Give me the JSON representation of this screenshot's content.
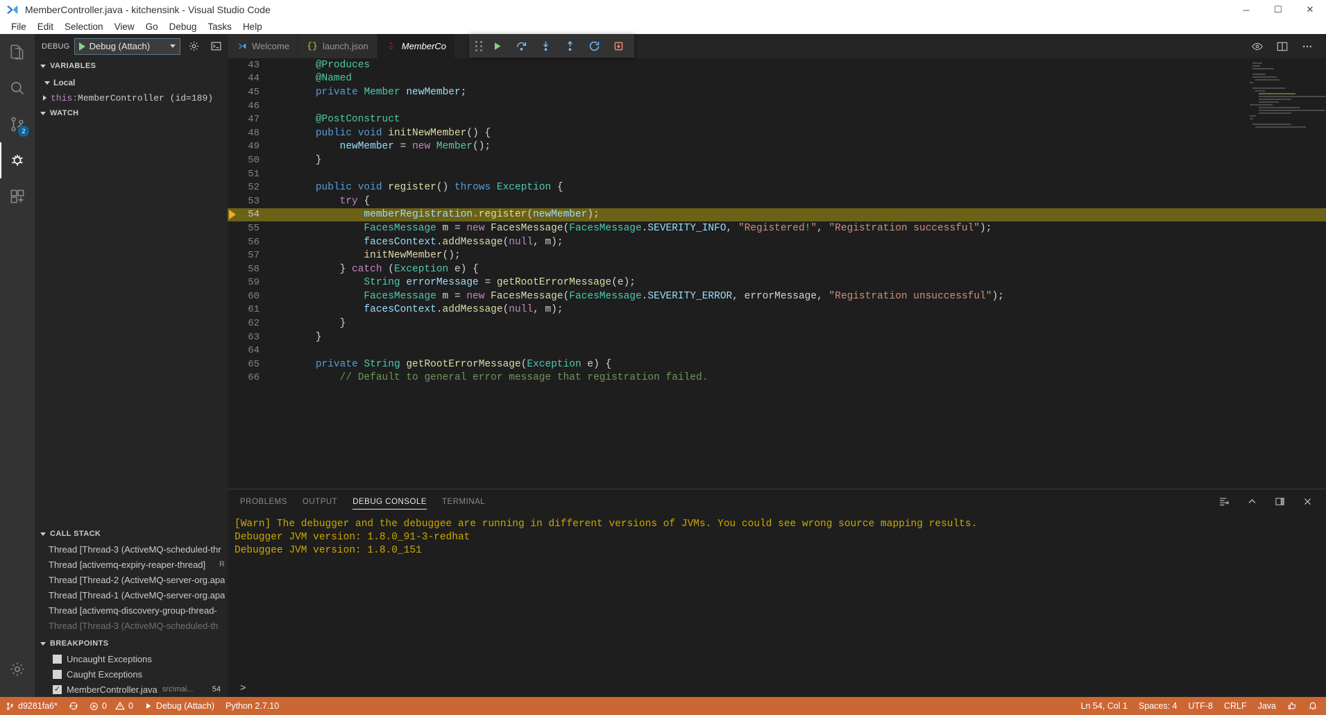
{
  "window": {
    "title": "MemberController.java - kitchensink - Visual Studio Code",
    "logo_icon": "vscode-logo-icon",
    "controls": [
      {
        "name": "minimize-button",
        "glyph": "─"
      },
      {
        "name": "maximize-button",
        "glyph": "☐"
      },
      {
        "name": "close-button",
        "glyph": "✕"
      }
    ]
  },
  "menubar": {
    "items": [
      "File",
      "Edit",
      "Selection",
      "View",
      "Go",
      "Debug",
      "Tasks",
      "Help"
    ]
  },
  "activitybar": {
    "items": [
      {
        "name": "explorer",
        "icon": "files-icon",
        "active": false,
        "badge": ""
      },
      {
        "name": "search",
        "icon": "search-icon",
        "active": false,
        "badge": ""
      },
      {
        "name": "source-control",
        "icon": "source-control-icon",
        "active": false,
        "badge": "2"
      },
      {
        "name": "debug",
        "icon": "debug-icon",
        "active": true,
        "badge": ""
      },
      {
        "name": "extensions",
        "icon": "extensions-icon",
        "active": false,
        "badge": ""
      }
    ],
    "bottom": [
      {
        "name": "manage",
        "icon": "gear-icon"
      }
    ]
  },
  "sidebar": {
    "toolbar": {
      "label": "DEBUG",
      "configuration": "Debug (Attach)",
      "start_icon": "play-icon",
      "dropdown_icon": "chevron-down-icon",
      "settings_icon": "gear-icon",
      "console_icon": "open-debug-console-icon"
    },
    "variables": {
      "title": "VARIABLES",
      "scopes": [
        {
          "name": "Local",
          "rows": [
            {
              "name": "this:",
              "value": " MemberController (id=189)"
            }
          ]
        }
      ]
    },
    "watch": {
      "title": "WATCH",
      "rows": []
    },
    "callstack": {
      "title": "CALL STACK",
      "rows": [
        {
          "text": "Thread [Thread-3 (ActiveMQ-scheduled-thr",
          "state": ""
        },
        {
          "text": "Thread [activemq-expiry-reaper-thread]",
          "state": "R"
        },
        {
          "text": "Thread [Thread-2 (ActiveMQ-server-org.apa",
          "state": ""
        },
        {
          "text": "Thread [Thread-1 (ActiveMQ-server-org.apa",
          "state": ""
        },
        {
          "text": "Thread [activemq-discovery-group-thread-",
          "state": ""
        },
        {
          "text": "Thread [Thread-3 (ActiveMQ-scheduled-th",
          "state": ""
        }
      ]
    },
    "breakpoints": {
      "title": "BREAKPOINTS",
      "rows": [
        {
          "label": "Uncaught Exceptions",
          "checked": false,
          "path": "",
          "line": ""
        },
        {
          "label": "Caught Exceptions",
          "checked": false,
          "path": "",
          "line": ""
        },
        {
          "label": "MemberController.java",
          "checked": true,
          "path": "src\\mai...",
          "line": "54"
        }
      ]
    }
  },
  "editor": {
    "tabs": [
      {
        "label": "Welcome",
        "icon": "vscode-logo-icon",
        "active": false
      },
      {
        "label": "launch.json",
        "icon": "json-braces-icon",
        "active": false
      },
      {
        "label": "MemberCon",
        "icon": "java-icon",
        "active": true
      }
    ],
    "actions": [
      {
        "name": "split-editor-preview-icon",
        "icon": "preview-icon"
      },
      {
        "name": "split-editor-icon",
        "icon": "split-icon"
      },
      {
        "name": "more-actions-icon",
        "icon": "ellipsis-icon"
      }
    ],
    "debug_toolbar": {
      "grip": "drag-grip",
      "buttons": [
        {
          "name": "continue-button",
          "icon": "play-icon",
          "color": "#89d185"
        },
        {
          "name": "step-over-button",
          "icon": "step-over-icon",
          "color": "#75beff"
        },
        {
          "name": "step-into-button",
          "icon": "step-into-icon",
          "color": "#75beff"
        },
        {
          "name": "step-out-button",
          "icon": "step-out-icon",
          "color": "#75beff"
        },
        {
          "name": "restart-button",
          "icon": "restart-icon",
          "color": "#75beff"
        },
        {
          "name": "stop-button",
          "icon": "stop-icon",
          "color": "#f48771"
        }
      ]
    },
    "highlight_line": 54,
    "breakpoint_line": 54,
    "lines": [
      {
        "n": 43,
        "tokens": [
          {
            "t": "    ",
            "c": "t-pl"
          },
          {
            "t": "@Produces",
            "c": "t-ann"
          }
        ]
      },
      {
        "n": 44,
        "tokens": [
          {
            "t": "    ",
            "c": "t-pl"
          },
          {
            "t": "@Named",
            "c": "t-ann"
          }
        ]
      },
      {
        "n": 45,
        "tokens": [
          {
            "t": "    ",
            "c": "t-pl"
          },
          {
            "t": "private",
            "c": "t-kw"
          },
          {
            "t": " ",
            "c": "t-pl"
          },
          {
            "t": "Member",
            "c": "t-type"
          },
          {
            "t": " ",
            "c": "t-pl"
          },
          {
            "t": "newMember",
            "c": "t-var"
          },
          {
            "t": ";",
            "c": "t-pl"
          }
        ]
      },
      {
        "n": 46,
        "tokens": []
      },
      {
        "n": 47,
        "tokens": [
          {
            "t": "    ",
            "c": "t-pl"
          },
          {
            "t": "@PostConstruct",
            "c": "t-ann"
          }
        ]
      },
      {
        "n": 48,
        "tokens": [
          {
            "t": "    ",
            "c": "t-pl"
          },
          {
            "t": "public",
            "c": "t-kw"
          },
          {
            "t": " ",
            "c": "t-pl"
          },
          {
            "t": "void",
            "c": "t-kw"
          },
          {
            "t": " ",
            "c": "t-pl"
          },
          {
            "t": "initNewMember",
            "c": "t-fn"
          },
          {
            "t": "() {",
            "c": "t-pl"
          }
        ]
      },
      {
        "n": 49,
        "tokens": [
          {
            "t": "        ",
            "c": "t-pl"
          },
          {
            "t": "newMember",
            "c": "t-var"
          },
          {
            "t": " = ",
            "c": "t-pl"
          },
          {
            "t": "new",
            "c": "t-ctl"
          },
          {
            "t": " ",
            "c": "t-pl"
          },
          {
            "t": "Member",
            "c": "t-type"
          },
          {
            "t": "();",
            "c": "t-pl"
          }
        ]
      },
      {
        "n": 50,
        "tokens": [
          {
            "t": "    }",
            "c": "t-pl"
          }
        ]
      },
      {
        "n": 51,
        "tokens": []
      },
      {
        "n": 52,
        "tokens": [
          {
            "t": "    ",
            "c": "t-pl"
          },
          {
            "t": "public",
            "c": "t-kw"
          },
          {
            "t": " ",
            "c": "t-pl"
          },
          {
            "t": "void",
            "c": "t-kw"
          },
          {
            "t": " ",
            "c": "t-pl"
          },
          {
            "t": "register",
            "c": "t-fn"
          },
          {
            "t": "() ",
            "c": "t-pl"
          },
          {
            "t": "throws",
            "c": "t-kw"
          },
          {
            "t": " ",
            "c": "t-pl"
          },
          {
            "t": "Exception",
            "c": "t-type"
          },
          {
            "t": " {",
            "c": "t-pl"
          }
        ]
      },
      {
        "n": 53,
        "tokens": [
          {
            "t": "        ",
            "c": "t-pl"
          },
          {
            "t": "try",
            "c": "t-ctl"
          },
          {
            "t": " {",
            "c": "t-pl"
          }
        ]
      },
      {
        "n": 54,
        "tokens": [
          {
            "t": "            ",
            "c": "t-pl"
          },
          {
            "t": "memberRegistration",
            "c": "t-var"
          },
          {
            "t": ".",
            "c": "t-pl"
          },
          {
            "t": "register",
            "c": "t-fn"
          },
          {
            "t": "(",
            "c": "t-pl"
          },
          {
            "t": "newMember",
            "c": "t-var"
          },
          {
            "t": ");",
            "c": "t-pl"
          }
        ]
      },
      {
        "n": 55,
        "tokens": [
          {
            "t": "            ",
            "c": "t-pl"
          },
          {
            "t": "FacesMessage",
            "c": "t-type"
          },
          {
            "t": " m = ",
            "c": "t-pl"
          },
          {
            "t": "new",
            "c": "t-ctl"
          },
          {
            "t": " ",
            "c": "t-pl"
          },
          {
            "t": "FacesMessage",
            "c": "t-fn"
          },
          {
            "t": "(",
            "c": "t-pl"
          },
          {
            "t": "FacesMessage",
            "c": "t-type"
          },
          {
            "t": ".",
            "c": "t-pl"
          },
          {
            "t": "SEVERITY_INFO",
            "c": "t-var"
          },
          {
            "t": ", ",
            "c": "t-pl"
          },
          {
            "t": "\"Registered!\"",
            "c": "t-str"
          },
          {
            "t": ", ",
            "c": "t-pl"
          },
          {
            "t": "\"Registration successful\"",
            "c": "t-str"
          },
          {
            "t": ");",
            "c": "t-pl"
          }
        ]
      },
      {
        "n": 56,
        "tokens": [
          {
            "t": "            ",
            "c": "t-pl"
          },
          {
            "t": "facesContext",
            "c": "t-var"
          },
          {
            "t": ".",
            "c": "t-pl"
          },
          {
            "t": "addMessage",
            "c": "t-fn"
          },
          {
            "t": "(",
            "c": "t-pl"
          },
          {
            "t": "null",
            "c": "t-ctl"
          },
          {
            "t": ", m);",
            "c": "t-pl"
          }
        ]
      },
      {
        "n": 57,
        "tokens": [
          {
            "t": "            ",
            "c": "t-pl"
          },
          {
            "t": "initNewMember",
            "c": "t-fn"
          },
          {
            "t": "();",
            "c": "t-pl"
          }
        ]
      },
      {
        "n": 58,
        "tokens": [
          {
            "t": "        } ",
            "c": "t-pl"
          },
          {
            "t": "catch",
            "c": "t-ctl"
          },
          {
            "t": " (",
            "c": "t-pl"
          },
          {
            "t": "Exception",
            "c": "t-type"
          },
          {
            "t": " e) {",
            "c": "t-pl"
          }
        ]
      },
      {
        "n": 59,
        "tokens": [
          {
            "t": "            ",
            "c": "t-pl"
          },
          {
            "t": "String",
            "c": "t-type"
          },
          {
            "t": " ",
            "c": "t-pl"
          },
          {
            "t": "errorMessage",
            "c": "t-var"
          },
          {
            "t": " = ",
            "c": "t-pl"
          },
          {
            "t": "getRootErrorMessage",
            "c": "t-fn"
          },
          {
            "t": "(e);",
            "c": "t-pl"
          }
        ]
      },
      {
        "n": 60,
        "tokens": [
          {
            "t": "            ",
            "c": "t-pl"
          },
          {
            "t": "FacesMessage",
            "c": "t-type"
          },
          {
            "t": " m = ",
            "c": "t-pl"
          },
          {
            "t": "new",
            "c": "t-ctl"
          },
          {
            "t": " ",
            "c": "t-pl"
          },
          {
            "t": "FacesMessage",
            "c": "t-fn"
          },
          {
            "t": "(",
            "c": "t-pl"
          },
          {
            "t": "FacesMessage",
            "c": "t-type"
          },
          {
            "t": ".",
            "c": "t-pl"
          },
          {
            "t": "SEVERITY_ERROR",
            "c": "t-var"
          },
          {
            "t": ", errorMessage, ",
            "c": "t-pl"
          },
          {
            "t": "\"Registration unsuccessful\"",
            "c": "t-str"
          },
          {
            "t": ");",
            "c": "t-pl"
          }
        ]
      },
      {
        "n": 61,
        "tokens": [
          {
            "t": "            ",
            "c": "t-pl"
          },
          {
            "t": "facesContext",
            "c": "t-var"
          },
          {
            "t": ".",
            "c": "t-pl"
          },
          {
            "t": "addMessage",
            "c": "t-fn"
          },
          {
            "t": "(",
            "c": "t-pl"
          },
          {
            "t": "null",
            "c": "t-ctl"
          },
          {
            "t": ", m);",
            "c": "t-pl"
          }
        ]
      },
      {
        "n": 62,
        "tokens": [
          {
            "t": "        }",
            "c": "t-pl"
          }
        ]
      },
      {
        "n": 63,
        "tokens": [
          {
            "t": "    }",
            "c": "t-pl"
          }
        ]
      },
      {
        "n": 64,
        "tokens": []
      },
      {
        "n": 65,
        "tokens": [
          {
            "t": "    ",
            "c": "t-pl"
          },
          {
            "t": "private",
            "c": "t-kw"
          },
          {
            "t": " ",
            "c": "t-pl"
          },
          {
            "t": "String",
            "c": "t-type"
          },
          {
            "t": " ",
            "c": "t-pl"
          },
          {
            "t": "getRootErrorMessage",
            "c": "t-fn"
          },
          {
            "t": "(",
            "c": "t-pl"
          },
          {
            "t": "Exception",
            "c": "t-type"
          },
          {
            "t": " e) {",
            "c": "t-pl"
          }
        ]
      },
      {
        "n": 66,
        "tokens": [
          {
            "t": "        ",
            "c": "t-pl"
          },
          {
            "t": "// Default to general error message that registration failed.",
            "c": "t-cmt"
          }
        ]
      }
    ]
  },
  "panel": {
    "tabs": [
      {
        "label": "PROBLEMS",
        "active": false
      },
      {
        "label": "OUTPUT",
        "active": false
      },
      {
        "label": "DEBUG CONSOLE",
        "active": true
      },
      {
        "label": "TERMINAL",
        "active": false
      }
    ],
    "actions": [
      {
        "name": "clear-console-icon"
      },
      {
        "name": "maximize-panel-icon"
      },
      {
        "name": "toggle-sidebar-icon"
      },
      {
        "name": "close-panel-icon"
      }
    ],
    "console_lines": [
      "[Warn] The debugger and the debuggee are running in different versions of JVMs. You could see wrong source mapping results.",
      "Debugger JVM version: 1.8.0_91-3-redhat",
      "Debuggee JVM version: 1.8.0_151"
    ],
    "input_prompt": ">"
  },
  "statusbar": {
    "left": [
      {
        "name": "branch",
        "icon": "source-control-icon",
        "text": "d9281fa6*"
      },
      {
        "name": "sync",
        "icon": "sync-icon",
        "text": ""
      },
      {
        "name": "errors",
        "icon": "error-icon",
        "text": "0"
      },
      {
        "name": "warnings",
        "icon": "warning-icon",
        "text": "0"
      },
      {
        "name": "debug-config",
        "icon": "play-icon",
        "text": "Debug (Attach)"
      },
      {
        "name": "python-version",
        "icon": "",
        "text": "Python 2.7.10"
      }
    ],
    "right": [
      {
        "name": "cursor-position",
        "text": "Ln 54, Col 1"
      },
      {
        "name": "indentation",
        "text": "Spaces: 4"
      },
      {
        "name": "encoding",
        "text": "UTF-8"
      },
      {
        "name": "eol",
        "text": "CRLF"
      },
      {
        "name": "language-mode",
        "text": "Java"
      },
      {
        "name": "feedback-icon",
        "text": ""
      },
      {
        "name": "bell-icon",
        "text": ""
      }
    ]
  },
  "colors": {
    "accent_orange": "#cc6633",
    "highlight_line": "#6b6218",
    "breakpoint": "#f5a623",
    "console_text": "#cca700"
  }
}
